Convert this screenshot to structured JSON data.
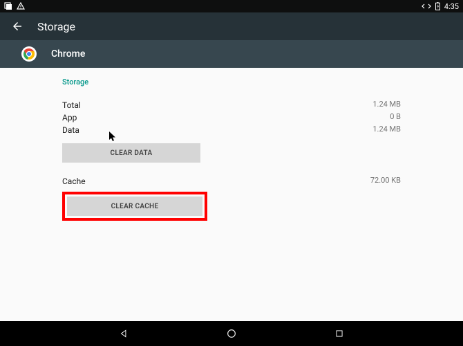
{
  "statusBar": {
    "time": "4:35"
  },
  "actionBar": {
    "title": "Storage"
  },
  "appHeader": {
    "name": "Chrome"
  },
  "storage": {
    "sectionTitle": "Storage",
    "total": {
      "label": "Total",
      "value": "1.24 MB"
    },
    "app": {
      "label": "App",
      "value": "0 B"
    },
    "data": {
      "label": "Data",
      "value": "1.24 MB"
    },
    "clearDataLabel": "CLEAR DATA",
    "cache": {
      "label": "Cache",
      "value": "72.00 KB"
    },
    "clearCacheLabel": "CLEAR CACHE"
  }
}
